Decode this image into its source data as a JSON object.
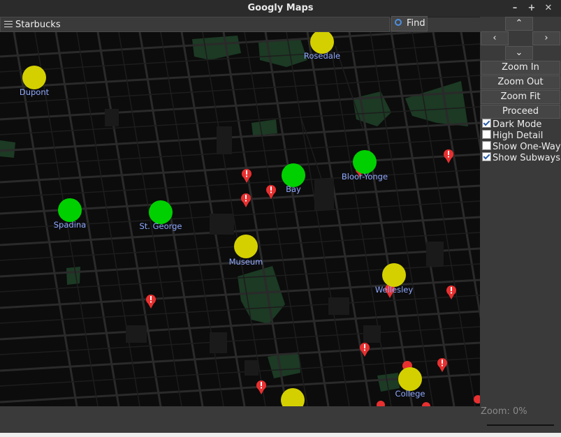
{
  "window": {
    "title": "Googly Maps"
  },
  "window_controls": [
    "–",
    "+",
    "✕"
  ],
  "search": {
    "value": "Starbucks",
    "find_label": "Find"
  },
  "nav": {
    "up": "⌃",
    "left": "‹",
    "right": "›",
    "down": "⌄"
  },
  "controls": {
    "zoom_in": "Zoom In",
    "zoom_out": "Zoom Out",
    "zoom_fit": "Zoom Fit",
    "proceed": "Proceed"
  },
  "toggles": [
    {
      "label": "Dark Mode",
      "checked": true
    },
    {
      "label": "High Detail",
      "checked": false
    },
    {
      "label": "Show One-Way",
      "checked": false
    },
    {
      "label": "Show Subways",
      "checked": true
    }
  ],
  "status": {
    "zoom": "Zoom: 0%"
  },
  "map": {
    "colors": {
      "background": "#0c0c0c",
      "road": "#2a2a2a",
      "park": "#1c3a24",
      "water_park": "#2b4a30",
      "yellow_station": "#d4d000",
      "green_station": "#00d000",
      "label": "#8fa8ff",
      "pin": "#e83030"
    },
    "stations": [
      {
        "name": "Rosedale",
        "color": "yellow"
      },
      {
        "name": "Dupont",
        "color": "yellow"
      },
      {
        "name": "Bloor-Yonge",
        "color": "green"
      },
      {
        "name": "Bay",
        "color": "green"
      },
      {
        "name": "Spadina",
        "color": "green"
      },
      {
        "name": "St. George",
        "color": "green"
      },
      {
        "name": "Museum",
        "color": "yellow"
      },
      {
        "name": "Wellesley",
        "color": "yellow"
      },
      {
        "name": "College",
        "color": "yellow"
      },
      {
        "name": "",
        "color": "yellow"
      }
    ]
  }
}
